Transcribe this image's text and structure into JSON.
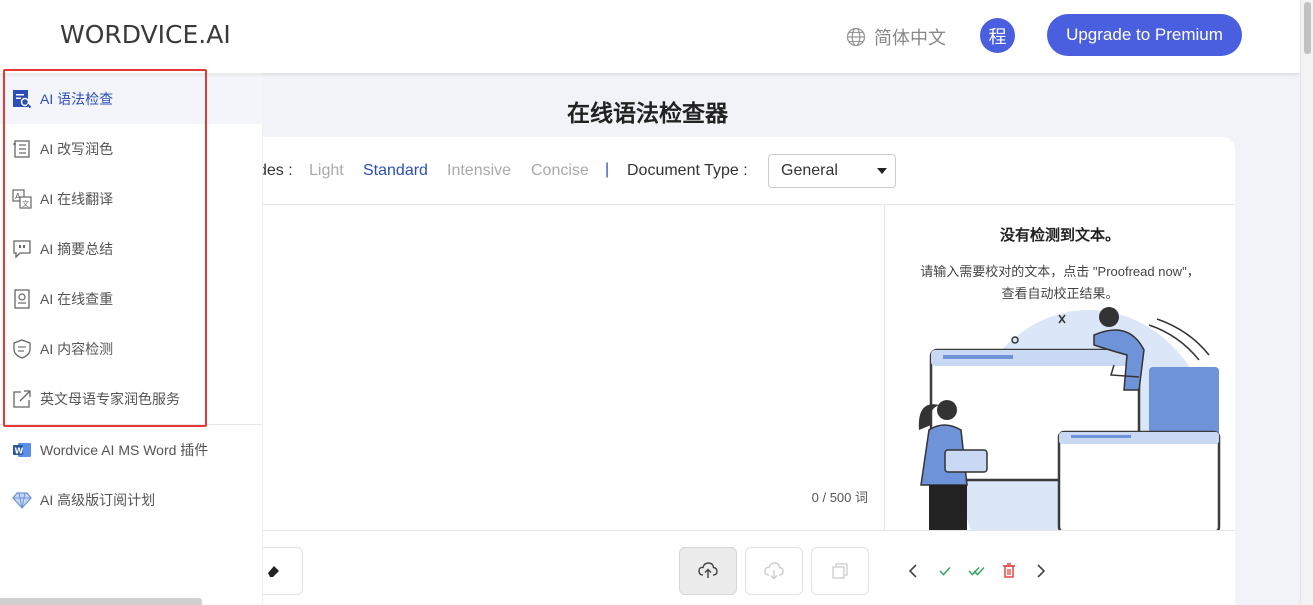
{
  "header": {
    "logo": "WORDVICE.AI",
    "language": "简体中文",
    "avatar_char": "程",
    "upgrade_label": "Upgrade to Premium"
  },
  "sidebar": {
    "items": [
      {
        "label": "AI 语法检查",
        "icon": "grammar-check-icon",
        "active": true
      },
      {
        "label": "AI 改写润色",
        "icon": "rewrite-icon"
      },
      {
        "label": "AI 在线翻译",
        "icon": "translate-icon"
      },
      {
        "label": "AI 摘要总结",
        "icon": "summary-icon"
      },
      {
        "label": "AI 在线查重",
        "icon": "plagiarism-icon"
      },
      {
        "label": "AI 内容检测",
        "icon": "ai-detect-icon"
      },
      {
        "label": "英文母语专家润色服务",
        "icon": "external-link-icon"
      }
    ],
    "extra": [
      {
        "label": "Wordvice AI MS Word 插件",
        "icon": "ms-word-icon"
      },
      {
        "label": "AI 高级版订阅计划",
        "icon": "diamond-icon"
      }
    ]
  },
  "main": {
    "title": "在线语法检查器",
    "modes_label": "des :",
    "modes": [
      "Light",
      "Standard",
      "Intensive",
      "Concise"
    ],
    "selected_mode": "Standard",
    "separator": "|",
    "doc_type_label": "Document Type :",
    "doc_type_value": "General",
    "word_count": "0 / 500 词",
    "result_title": "没有检测到文本。",
    "result_line1": "请输入需要校对的文本，点击 \"Proofread now\"，",
    "result_line2": "查看自动校正结果。"
  },
  "colors": {
    "accent": "#4a5ee0",
    "active_text": "#2d4fb5",
    "highlight_box": "#e53935"
  }
}
